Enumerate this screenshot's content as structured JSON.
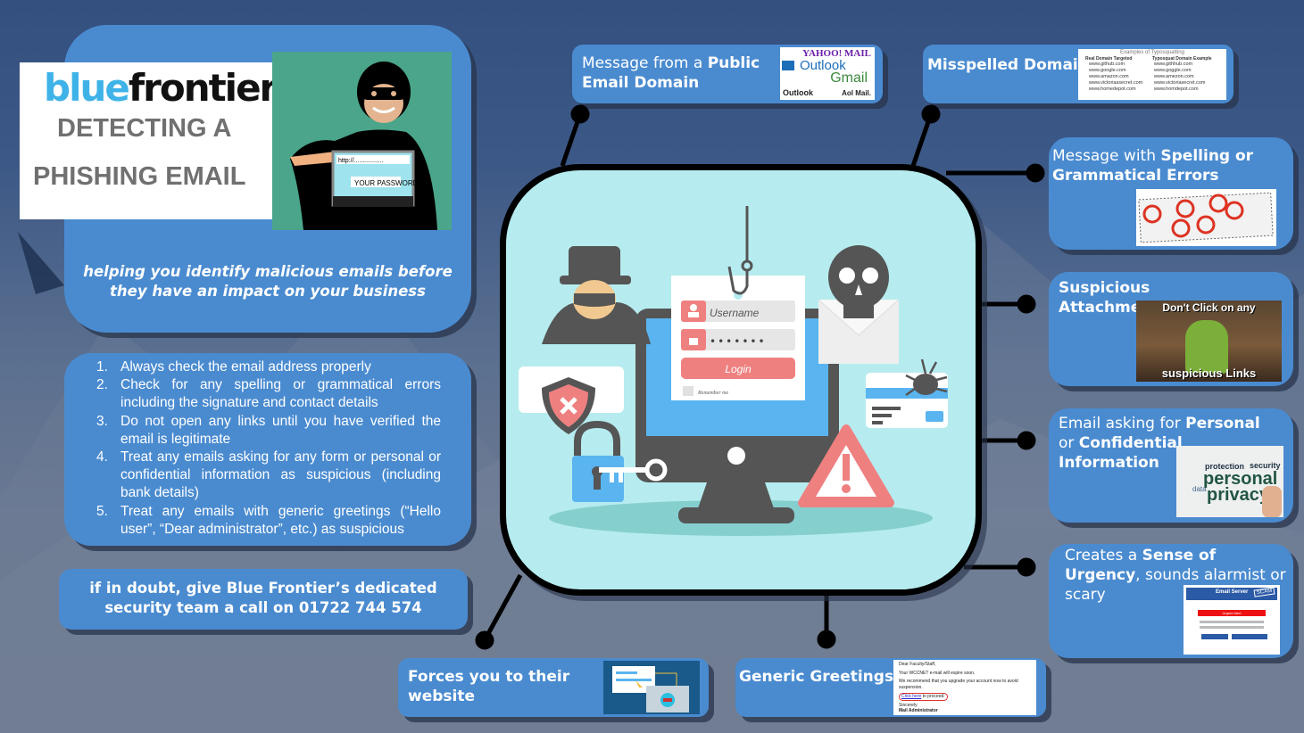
{
  "header": {
    "logo_part1": "blue",
    "logo_part2": "frontier",
    "title_line1": "DETECTING A",
    "title_line2": "PHISHING EMAIL",
    "hacker_image": {
      "url_text": "http://.................",
      "password_text": "YOUR PASSWORD"
    },
    "tagline_line1": "helping you identify malicious emails before",
    "tagline_line2": "they have an impact on your business"
  },
  "steps": [
    {
      "num": "1.",
      "text": "Always check the email address properly"
    },
    {
      "num": "2.",
      "text": "Check for any spelling or grammatical errors including the signature and contact details"
    },
    {
      "num": "3.",
      "text": "Do not open any links until you have verified the email is legitimate"
    },
    {
      "num": "4.",
      "text": "Treat any emails asking for any form or personal or confidential information as suspicious (including bank details)"
    },
    {
      "num": "5.",
      "text": "Treat any emails with generic greetings (“Hello user”, “Dear administrator”, etc.) as suspicious"
    }
  ],
  "cta": {
    "line1": "if in doubt, give Blue Frontier’s dedicated",
    "line2": "security team a call on 01722 744 574"
  },
  "center_illustration": {
    "username_label": "Username",
    "password_mask": "•••••••",
    "login_label": "Login",
    "remember_label": "Remember me",
    "icons": [
      "hacker-icon",
      "fish-hook-icon",
      "skull-envelope-icon",
      "shield-x-icon",
      "padlock-key-icon",
      "bug-card-icon",
      "warning-triangle-icon",
      "monitor-icon"
    ]
  },
  "callouts": {
    "public_domain": {
      "prefix": "Message from a ",
      "bold": "Public Email Domain",
      "logos": [
        "YAHOO! MAIL",
        "Outlook",
        "Gmail",
        "Outlook",
        "Aol Mail."
      ]
    },
    "misspelled": {
      "bold": "Misspelled Domain",
      "table_title": "Examples of Typosquatting",
      "col1": "Real Domain Targeted",
      "col2": "Typosquat Domain Example",
      "rows": [
        [
          "www.github.com",
          "www.githhub.com"
        ],
        [
          "www.google.com",
          "www.goggle.com"
        ],
        [
          "www.amazon.com",
          "www.amezon.com"
        ],
        [
          "www.victoriassecret.com",
          "www.victoriasecret.com"
        ],
        [
          "www.homedepot.com",
          "www.homdepot.com"
        ]
      ]
    },
    "spelling": {
      "prefix": "Message with ",
      "bold": "Spelling or Grammatical Errors"
    },
    "attachments": {
      "bold": "Suspicious Attachments or Links",
      "meme_top": "Don't Click on any",
      "meme_bottom": "suspicious Links"
    },
    "personal": {
      "prefix1": "Email asking for ",
      "bold1": "Personal",
      "prefix2": "or ",
      "bold2": "Confidential",
      "bold3": "Information",
      "cloud_words": [
        "protection",
        "security",
        "personal",
        "data",
        "privacy"
      ]
    },
    "urgency": {
      "prefix": "Creates a ",
      "bold1": "Sense of",
      "bold2": "Urgency",
      "suffix": ", sounds alarmist or scary",
      "header": "Email Server",
      "stamp": "SCAM",
      "alert": "Urgent Alert"
    },
    "forces": {
      "bold": "Forces you to their website"
    },
    "generic": {
      "bold": "Generic Greetings",
      "email_lines": [
        "Dear Faculty/Staff,",
        "Your WCCNET e-mail will expire soon.",
        "We recommend that you upgrade your account now to avoid suspension.",
        "Click here",
        " to proceed.",
        "Sincerely",
        "Mail Administrator"
      ]
    }
  },
  "colors": {
    "panel_blue": "#4a8bd0",
    "center_bg": "#b6ecef",
    "logo_blue": "#3fb3e8",
    "title_gray": "#707070",
    "accent_red": "#ef8080",
    "monitor_blue": "#5ab4f0",
    "dark_gray": "#555555"
  }
}
